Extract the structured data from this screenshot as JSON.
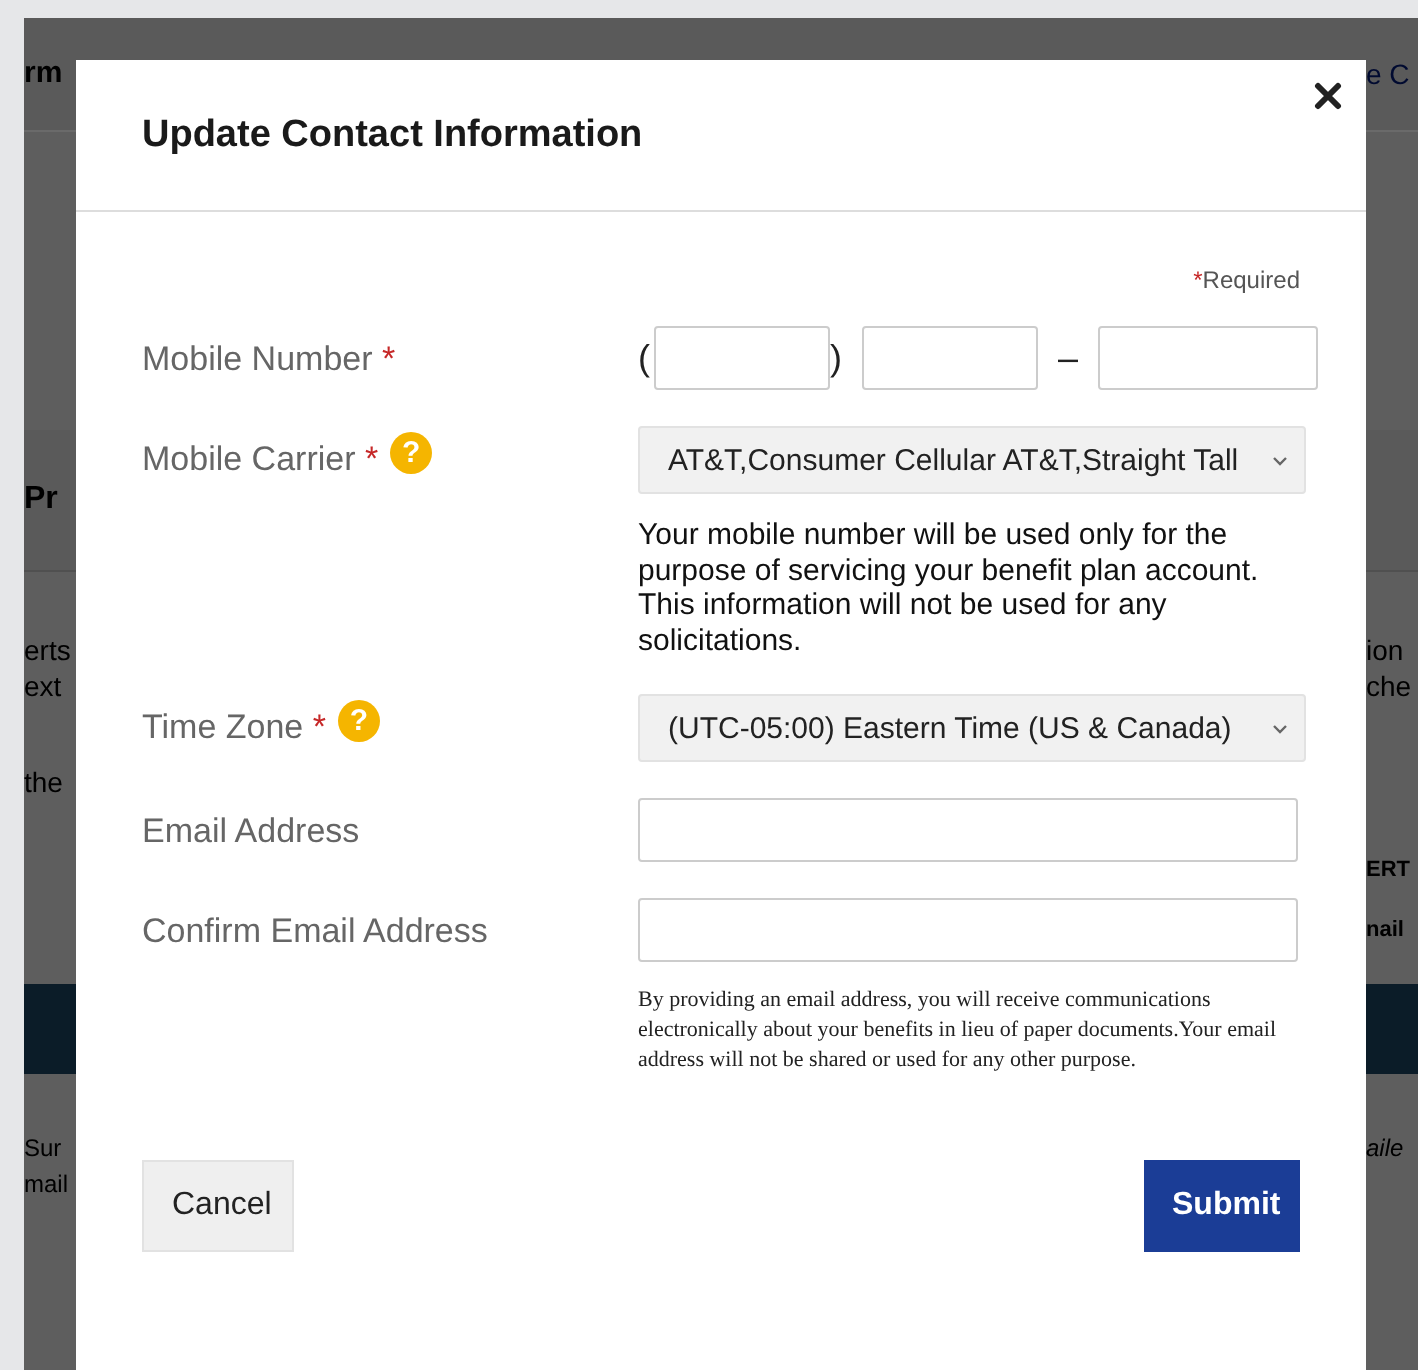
{
  "background_page": {
    "rows": [
      {
        "kind": "header",
        "left": "rm",
        "right": "e C"
      },
      {
        "kind": "section",
        "left": "Pr",
        "right": ""
      },
      {
        "kind": "text",
        "left": "erts\next",
        "right": "ion\nche"
      },
      {
        "kind": "text",
        "left": "the",
        "right": ""
      },
      {
        "kind": "bold",
        "left": "",
        "right": "ERT\nnail"
      },
      {
        "kind": "band",
        "left": "",
        "right": ""
      },
      {
        "kind": "italic",
        "left": "Sur\nmail",
        "right": "aile"
      }
    ]
  },
  "dialog": {
    "title": "Update Contact Information",
    "required_note": {
      "mark": "*",
      "text": "Required"
    },
    "fields": [
      {
        "kind": "phone",
        "label": "Mobile Number",
        "required_mark": "*",
        "separators": [
          "(",
          ")",
          "–"
        ]
      },
      {
        "kind": "select",
        "label": "Mobile Carrier",
        "required_mark": "*",
        "help": "?",
        "value": "AT&T,Consumer Cellular AT&T,Straight Tall",
        "note": "Your mobile number will be used only for the purpose of servicing your benefit plan account. This information will not be used for any solicitations."
      },
      {
        "kind": "select",
        "label": "Time Zone",
        "required_mark": "*",
        "help": "?",
        "value": "(UTC-05:00) Eastern Time (US & Canada)"
      },
      {
        "kind": "text",
        "label": "Email Address"
      },
      {
        "kind": "text",
        "label": "Confirm Email Address",
        "fine_print": "By providing an email address, you will receive communications electronically about your benefits in lieu of paper documents.Your email address will not be shared or used for any other purpose."
      }
    ],
    "buttons": [
      {
        "kind": "secondary",
        "label": "Cancel"
      },
      {
        "kind": "primary",
        "label": "Submit"
      }
    ]
  }
}
